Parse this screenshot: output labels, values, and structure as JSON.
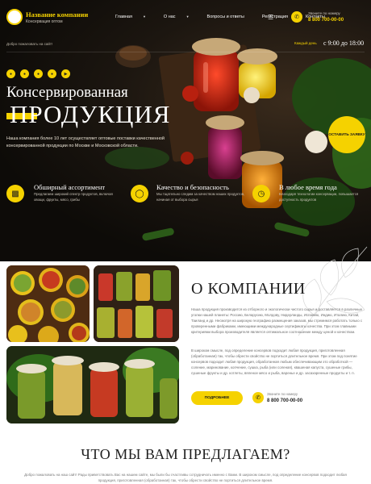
{
  "header": {
    "company_name": "Название компании",
    "slogan": "Консервация оптом",
    "nav": [
      {
        "label": "Главная",
        "dropdown": true
      },
      {
        "label": "О нас",
        "dropdown": true
      },
      {
        "label": "Вопросы и ответы",
        "dropdown": false
      },
      {
        "label": "Регистрация",
        "dropdown": false
      },
      {
        "label": "Контакты",
        "dropdown": false
      }
    ],
    "menu_icon": "hamburger-icon",
    "phone_label": "Звоните по номеру",
    "phone": "8 800 700-00-00"
  },
  "subbar": {
    "welcome": "Добро пожаловать на сайт!",
    "days": "Каждый день",
    "hours": "с 9:00 до 18:00",
    "social_icons": [
      "vk-icon",
      "telegram-icon",
      "whatsapp-icon",
      "viber-icon",
      "youtube-icon"
    ]
  },
  "hero": {
    "title_line1": "Консервированная",
    "title_line2": "ПРОДУКЦИЯ",
    "description": "Наша компания более 10 лет осуществляет оптовые поставки качественной консервированной продукции по Москве и Московской области.",
    "order_button": "ОСТАВИТЬ ЗАЯВКУ"
  },
  "features": [
    {
      "icon": "jar-icon",
      "title": "Обширный ассортимент",
      "text": "Предлагаем широкий спектр продуктов, включая овощи, фрукты, мясо, грибы"
    },
    {
      "icon": "shield-icon",
      "title": "Качество и безопасность",
      "text": "Мы тщательно следим за качеством наших продуктов, начиная от выбора сырья"
    },
    {
      "icon": "clock-icon",
      "title": "В любое время года",
      "text": "Благодаря технологии консервации, повышается доступность продуктов"
    }
  ],
  "about": {
    "title": "О КОМПАНИИ",
    "paragraph1": "Наша продукция производится из отборного и экологически чистого сырья и доставляется в различные уголки нашей планеты: Россию, Беларусию, Молдову, Нидерланды, Испанию, Индию, Италию, Китай, Таиланд и др. Несмотря на широкую географию размещения заказов, мы стремимся работать только с проверенными фабриками, имеющими международные сертификаты качества. При этом главными критериями выбора производителя является оптимальное соотношение между ценой и качеством.",
    "paragraph2": "В широком смысле, под определение консервов подходит любая продукция, приготовленная (обработанная) так, чтобы обрести свойство не портиться длительное время. При этом под понятие консервов подходит любая продукция, обработанная любым обеспечивающим это обработкой — соление, маринование, копчение, сушка, рыба (или соленая), квашеная капуста, сушеные грибы, сушеные фрукты и др. котлеты, вяленое мясо и рыба, варенье и др. засахаренные продукты и т. п.",
    "more_button": "ПОДРОБНЕЕ",
    "phone_label": "Звоните по номеру",
    "phone": "8 800 700-00-00"
  },
  "offer": {
    "title": "ЧТО МЫ ВАМ ПРЕДЛАГАЕМ?",
    "description": "Добро пожаловать на наш сайт! Рады приветствовать Вас на нашем сайте, мы были бы счастливы сотрудничать именно с Вами. В широком смысле, под определение консервов подходит любая продукция, приготовленная (обработанная) так, чтобы обрести свойство не портиться длительное время."
  },
  "colors": {
    "accent": "#f5d200",
    "hero_bg": "#0d0b08",
    "text_dark": "#1e1e1e"
  }
}
